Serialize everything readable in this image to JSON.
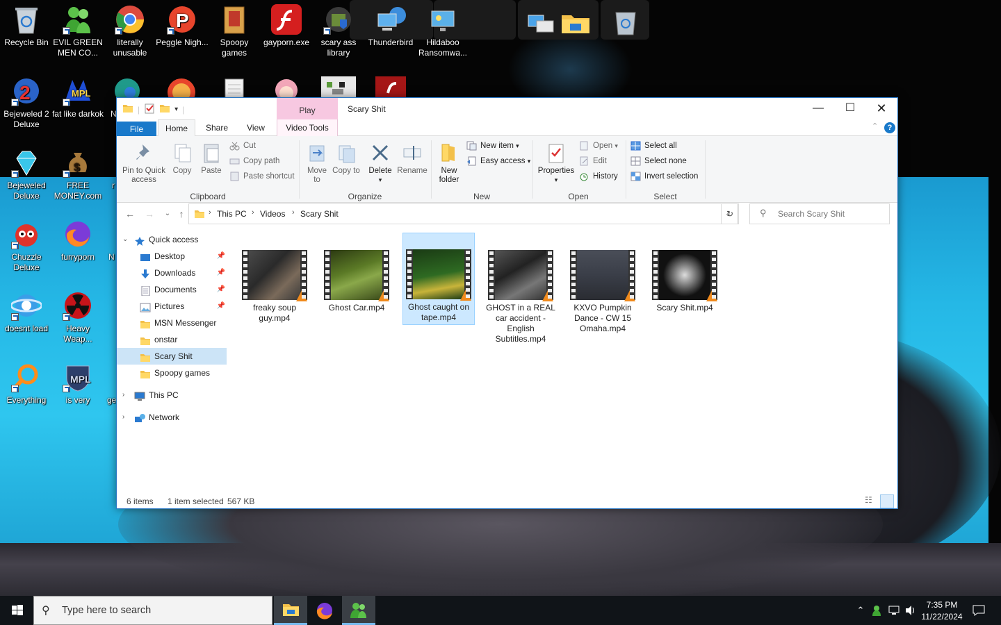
{
  "desktop": {
    "icons": [
      {
        "label": "Recycle Bin",
        "icon": "recycle-bin-icon"
      },
      {
        "label": "EVIL GREEN MEN CO...",
        "icon": "messenger-people-icon"
      },
      {
        "label": "literally unusable",
        "icon": "chrome-icon"
      },
      {
        "label": "Peggle Nigh...",
        "icon": "peggle-icon"
      },
      {
        "label": "Spoopy games",
        "icon": "folder-icon"
      },
      {
        "label": "gayporn.exe",
        "icon": "flash-icon"
      },
      {
        "label": "scary ass library",
        "icon": "library-icon"
      },
      {
        "label": "Thunderbird",
        "icon": "network-computers-icon"
      },
      {
        "label": "Hildaboo Ransomwa...",
        "icon": "monitor-icon"
      },
      {
        "label": "Bejeweled 2 Deluxe",
        "icon": "bejeweled2-icon"
      },
      {
        "label": "fat like darkok",
        "icon": "media-player-icon"
      },
      {
        "label": "Bejeweled Deluxe",
        "icon": "diamond-icon"
      },
      {
        "label": "FREE MONEY.com",
        "icon": "money-bag-icon"
      },
      {
        "label": "Chuzzle Deluxe",
        "icon": "chuzzle-icon"
      },
      {
        "label": "furryporn",
        "icon": "firefox-icon"
      },
      {
        "label": "doesnt load",
        "icon": "internet-explorer-icon"
      },
      {
        "label": "Heavy Weap...",
        "icon": "radiation-icon"
      },
      {
        "label": "Everything",
        "icon": "magnifier-icon"
      },
      {
        "label": "is very",
        "icon": "media-shield-icon"
      },
      {
        "label": "N",
        "icon": "partial-icon"
      },
      {
        "label": "N",
        "icon": "partial-icon"
      },
      {
        "label": "r",
        "icon": "partial-icon"
      },
      {
        "label": "ge",
        "icon": "partial-icon"
      }
    ]
  },
  "window": {
    "title": "Scary Shit",
    "context_tab": "Play",
    "context_group": "Video Tools",
    "tabs": [
      "File",
      "Home",
      "Share",
      "View"
    ],
    "ribbon": {
      "clipboard": {
        "label": "Clipboard",
        "pin": "Pin to Quick access",
        "copy": "Copy",
        "paste": "Paste",
        "cut": "Cut",
        "copy_path": "Copy path",
        "paste_shortcut": "Paste shortcut"
      },
      "organize": {
        "label": "Organize",
        "move_to": "Move to",
        "copy_to": "Copy to",
        "delete": "Delete",
        "rename": "Rename"
      },
      "new": {
        "label": "New",
        "new_folder": "New folder",
        "new_item": "New item",
        "easy_access": "Easy access"
      },
      "open": {
        "label": "Open",
        "properties": "Properties",
        "open": "Open",
        "edit": "Edit",
        "history": "History"
      },
      "select": {
        "label": "Select",
        "select_all": "Select all",
        "select_none": "Select none",
        "invert_selection": "Invert selection"
      }
    },
    "address": {
      "crumbs": [
        "This PC",
        "Videos",
        "Scary Shit"
      ],
      "search_placeholder": "Search Scary Shit"
    },
    "nav": {
      "quick_access": "Quick access",
      "items": [
        {
          "label": "Desktop",
          "pinned": true
        },
        {
          "label": "Downloads",
          "pinned": true
        },
        {
          "label": "Documents",
          "pinned": true
        },
        {
          "label": "Pictures",
          "pinned": true
        },
        {
          "label": "MSN Messenger",
          "pinned": false
        },
        {
          "label": "onstar",
          "pinned": false
        },
        {
          "label": "Scary Shit",
          "pinned": false
        },
        {
          "label": "Spoopy games",
          "pinned": false
        }
      ],
      "this_pc": "This PC",
      "network": "Network"
    },
    "files": [
      {
        "name": "freaky soup guy.mp4",
        "selected": false
      },
      {
        "name": "Ghost Car.mp4",
        "selected": false
      },
      {
        "name": "Ghost caught on tape.mp4",
        "selected": true
      },
      {
        "name": "GHOST in a REAL car accident - English Subtitles.mp4",
        "selected": false
      },
      {
        "name": "KXVO Pumpkin Dance - CW 15 Omaha.mp4",
        "selected": false
      },
      {
        "name": "Scary Shit.mp4",
        "selected": false
      }
    ],
    "status": {
      "count": "6 items",
      "selection": "1 item selected",
      "size": "567 KB"
    }
  },
  "taskbar": {
    "search_placeholder": "Type here to search",
    "time": "7:35 PM",
    "date": "11/22/2024"
  },
  "colors": {
    "accent": "#1979ca",
    "selection": "#cce8ff",
    "context_tab": "#f7c8e1",
    "wallpaper_cyan": "#25b8e6"
  }
}
